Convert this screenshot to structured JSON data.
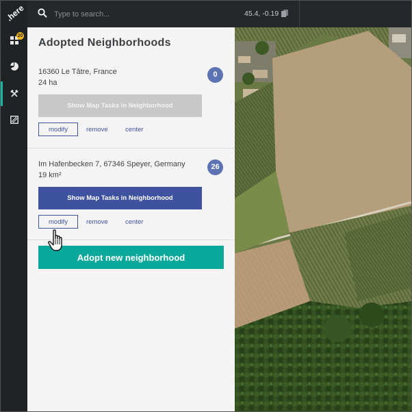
{
  "logo": {
    "text": ".here",
    "icon": "here-logo"
  },
  "rail": {
    "items": [
      {
        "name": "dashboard",
        "icon": "grid-icon",
        "badge": "20"
      },
      {
        "name": "statistics",
        "icon": "pie-chart-icon"
      },
      {
        "name": "tools",
        "icon": "hammer-wrench-icon",
        "active": true
      },
      {
        "name": "map-tasks",
        "icon": "map-square-icon"
      }
    ]
  },
  "search": {
    "placeholder": "Type to search...",
    "value": ""
  },
  "coords": "45.4, -0.19",
  "panel": {
    "title": "Adopted Neighborhoods"
  },
  "neighborhoods": [
    {
      "address": "16360 Le Tâtre, France",
      "area": "24 ha",
      "count": "0",
      "show_label": "Show Map Tasks in Neighborhood",
      "show_enabled": false,
      "modify": "modify",
      "remove": "remove",
      "center": "center"
    },
    {
      "address": "Im Hafenbecken 7, 67346 Speyer, Germany",
      "area": "19 km²",
      "count": "26",
      "show_label": "Show Map Tasks in Neighborhood",
      "show_enabled": true,
      "modify": "modify",
      "remove": "remove",
      "center": "center"
    }
  ],
  "adopt_button": "Adopt new neighborhood",
  "colors": {
    "rail_bg": "#1f2326",
    "topbar_bg": "#24282b",
    "accent_teal": "#0aa99c",
    "primary_blue": "#3f52a0",
    "count_badge": "#5d72b3",
    "notification_badge": "#f2b619"
  }
}
